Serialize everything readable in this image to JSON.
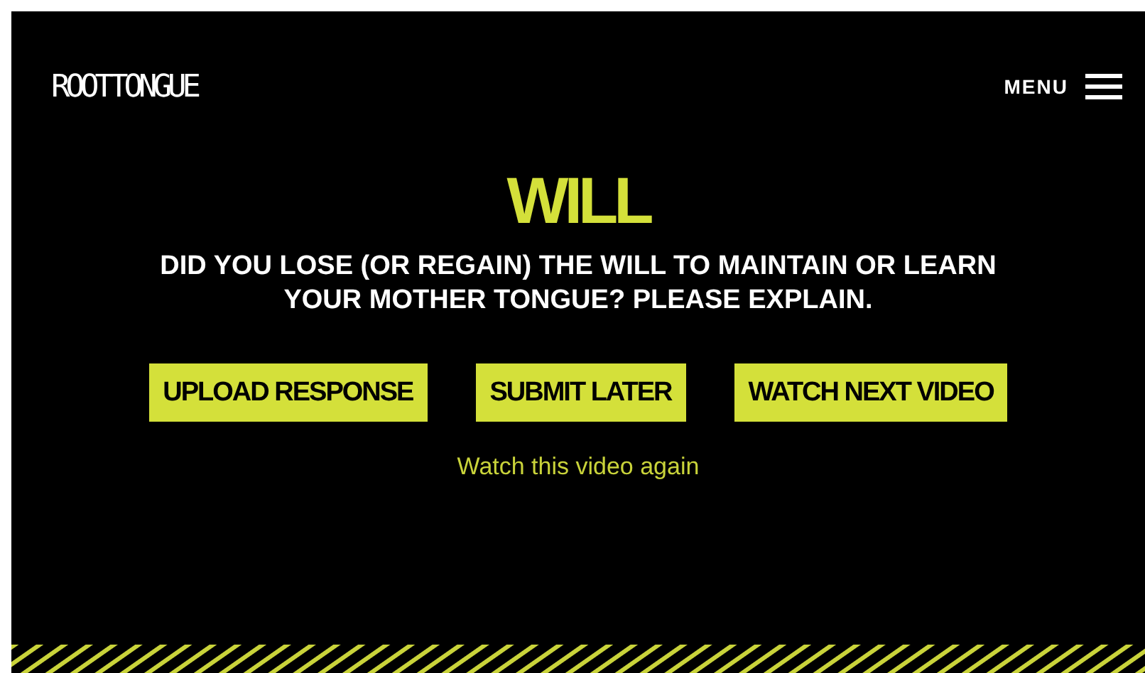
{
  "header": {
    "logo": "ROOTTONGUE",
    "menu_label": "MENU"
  },
  "title": "WILL",
  "question": "DID YOU LOSE (OR REGAIN) THE WILL TO MAINTAIN OR LEARN YOUR MOTHER TONGUE? PLEASE EXPLAIN.",
  "buttons": [
    "UPLOAD RESPONSE",
    "SUBMIT LATER",
    "WATCH NEXT VIDEO"
  ],
  "link": "Watch this video again"
}
